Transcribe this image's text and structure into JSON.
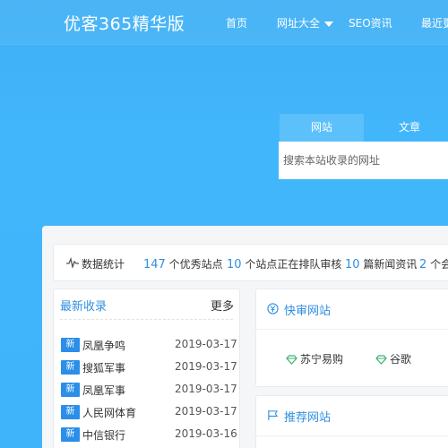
{
  "header": {
    "logo": "优客365精华版",
    "nav": [
      "首页",
      "网址大全",
      "SEO资讯",
      "最近更"
    ]
  },
  "search": {
    "tabs": [
      "网站",
      "文章"
    ],
    "placeholder": "搜索本站收录的网址"
  },
  "stats": {
    "label": "数据统计",
    "items": [
      {
        "num": "147",
        "text": "个优秀站点"
      },
      {
        "num": "10",
        "text": "个站点正在排队审核"
      },
      {
        "num": "10",
        "text": "篇新闻资讯"
      },
      {
        "num": "2",
        "text": "个会"
      }
    ]
  },
  "latest": {
    "title": "最新收录",
    "more": "更多",
    "badge": "新",
    "items": [
      {
        "name": "凤凰争鸣",
        "date": "2019-03-17"
      },
      {
        "name": "搜狐军事",
        "date": "2019-03-17"
      },
      {
        "name": "凤凰军事",
        "date": "2019-03-17"
      },
      {
        "name": "人民网体育",
        "date": "2019-03-17"
      },
      {
        "name": "中信银行",
        "date": "2019-03-16"
      }
    ]
  },
  "quick": {
    "title": "快审网站",
    "sites": [
      "苏宁易购",
      "谷歌"
    ]
  },
  "recommend": {
    "title": "推荐网站"
  },
  "colors": {
    "accent": "#2f8fe0",
    "background": "#40b4fb",
    "badge": "#2b8ee8"
  }
}
